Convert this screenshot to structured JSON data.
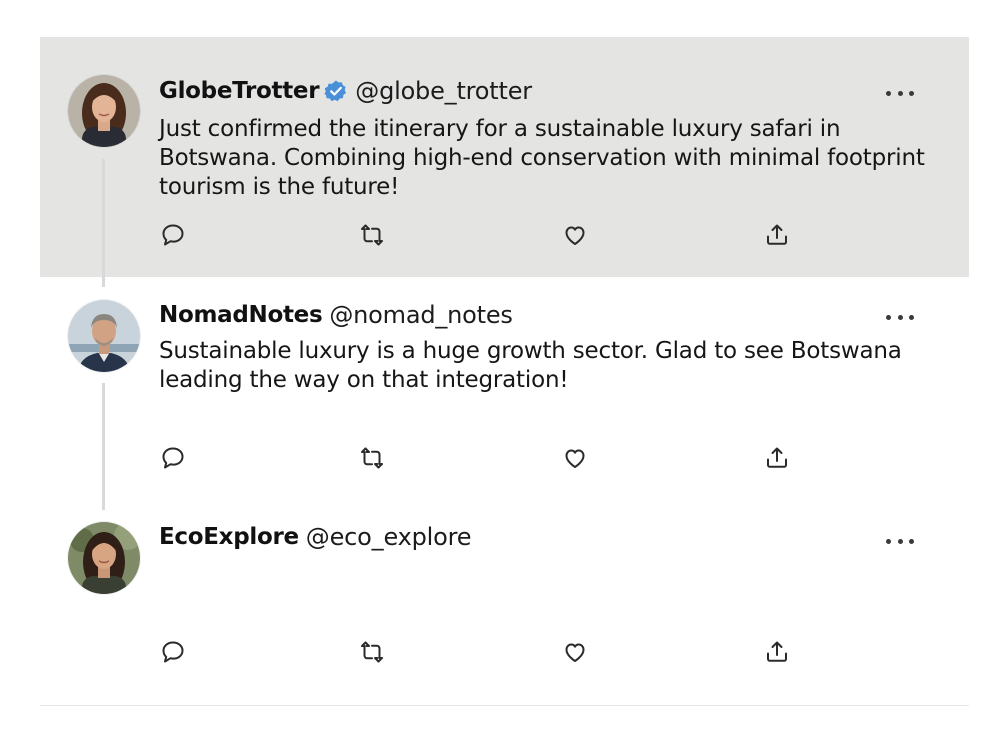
{
  "colors": {
    "highlight_bg": "#e4e4e3",
    "verified_badge": "#4a90d9",
    "text": "#141414",
    "icon": "#2b2b2b"
  },
  "tweets": [
    {
      "display_name": "GlobeTrotter",
      "verified": true,
      "handle": "@globe_trotter",
      "text": "Just confirmed the itinerary for a sustainable luxury safari in Botswana. Combining high-end conservation with minimal footprint tourism is the future!",
      "highlighted": true,
      "avatar": "woman-long-brown-hair-avatar"
    },
    {
      "display_name": "NomadNotes",
      "verified": false,
      "handle": "@nomad_notes",
      "text": "Sustainable luxury is a huge growth sector. Glad to see Botswana leading the way on that integration!",
      "highlighted": false,
      "avatar": "man-grey-hair-suit-avatar"
    },
    {
      "display_name": "EcoExplore",
      "verified": false,
      "handle": "@eco_explore",
      "text": "",
      "highlighted": false,
      "avatar": "woman-dark-hair-outdoor-avatar"
    }
  ],
  "icons": {
    "reply": "reply-icon",
    "retweet": "retweet-icon",
    "like": "heart-icon",
    "share": "share-icon",
    "more": "more-options-icon",
    "verified": "verified-badge-icon"
  }
}
